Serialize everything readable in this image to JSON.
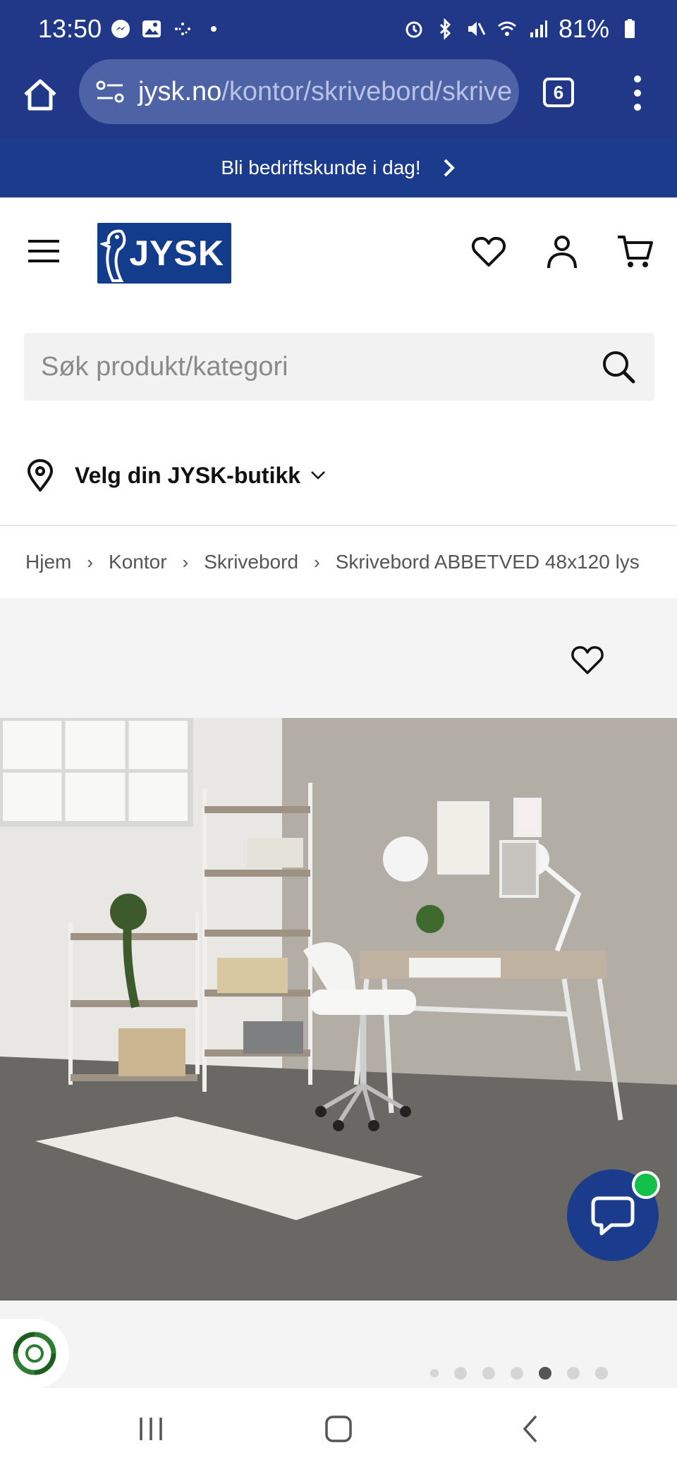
{
  "status": {
    "time": "13:50",
    "battery": "81%"
  },
  "browser": {
    "url_domain": "jysk.no",
    "url_path": "/kontor/skrivebord/skrive",
    "tab_count": "6"
  },
  "promo": {
    "text": "Bli bedriftskunde i dag!"
  },
  "header": {
    "logo_text": "JYSK"
  },
  "search": {
    "placeholder": "Søk produkt/kategori"
  },
  "store": {
    "label": "Velg din JYSK-butikk"
  },
  "breadcrumb": {
    "items": [
      "Hjem",
      "Kontor",
      "Skrivebord",
      "Skrivebord ABBETVED 48x120 lys"
    ]
  },
  "gallery": {
    "image_count": 7,
    "active_index": 4
  },
  "colors": {
    "browser_bar": "#213787",
    "brand_blue": "#1b3c8c",
    "chat_badge": "#13c04a"
  }
}
